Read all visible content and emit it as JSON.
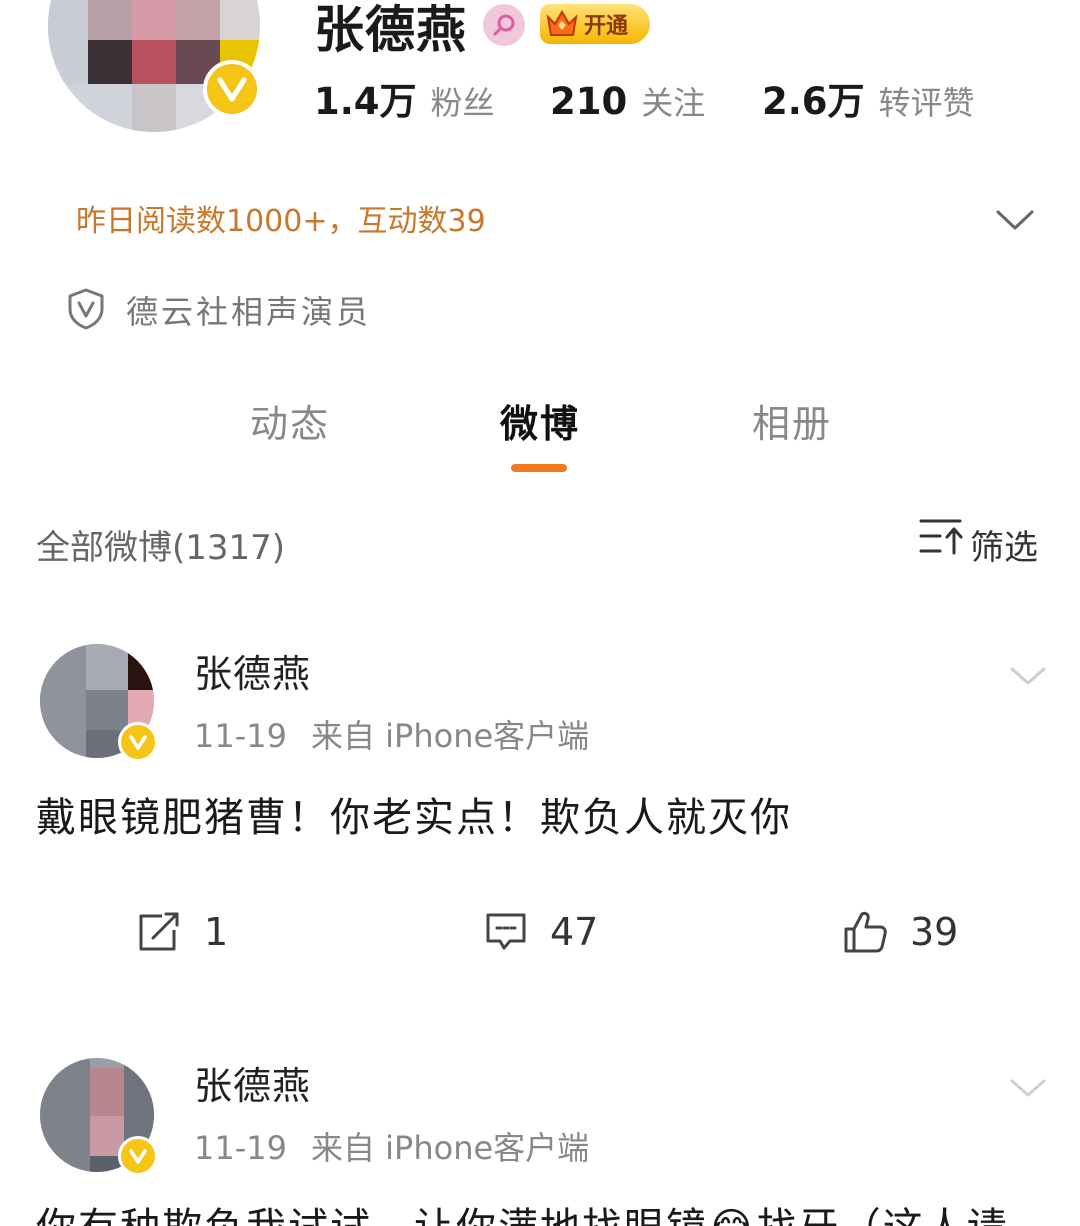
{
  "profile": {
    "name": "张德燕",
    "vip_label": "开通",
    "stats": [
      {
        "value": "1.4万",
        "label": "粉丝"
      },
      {
        "value": "210",
        "label": "关注"
      },
      {
        "value": "2.6万",
        "label": "转评赞"
      }
    ],
    "reads_summary": "昨日阅读数1000+，互动数39",
    "certification": "德云社相声演员"
  },
  "tabs": [
    {
      "label": "动态",
      "active": false
    },
    {
      "label": "微博",
      "active": true
    },
    {
      "label": "相册",
      "active": false
    }
  ],
  "feed": {
    "all_label": "全部微博(1317)",
    "filter_label": "筛选"
  },
  "posts": [
    {
      "author": "张德燕",
      "date": "11-19",
      "source": "来自 iPhone客户端",
      "text": "戴眼镜肥猪曹！你老实点！欺负人就灭你",
      "reposts": "1",
      "comments": "47",
      "likes": "39"
    },
    {
      "author": "张德燕",
      "date": "11-19",
      "source": "来自 iPhone客户端",
      "text": "你有种欺负我试试，让你满地找眼镜😂找牙（这人请"
    }
  ],
  "colors": {
    "accent_orange": "#f07a1d",
    "reads_text": "#c8782a",
    "verified_yellow": "#f5c518",
    "vip_gold": "#f6b500"
  }
}
